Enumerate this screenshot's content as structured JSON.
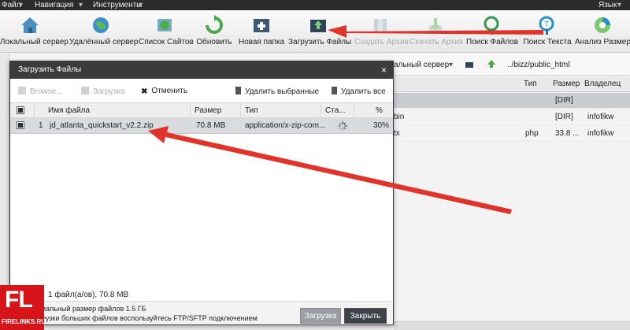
{
  "menubar": {
    "items": [
      "Файл",
      "Навигация",
      "Инструменты"
    ],
    "right": "Язык"
  },
  "toolbar": {
    "buttons": [
      {
        "label": "Локальный сервер",
        "icon": "home-icon"
      },
      {
        "label": "Удалённый сервер",
        "icon": "globe-icon"
      },
      {
        "label": "Список Сайтов",
        "icon": "sites-list-icon"
      },
      {
        "label": "Обновить",
        "icon": "refresh-icon"
      },
      {
        "label": "Новая папка",
        "icon": "new-folder-icon"
      },
      {
        "label": "Загрузить Файлы",
        "icon": "upload-icon"
      },
      {
        "label": "Создать Архив",
        "icon": "archive-icon"
      },
      {
        "label": "Скачать Архив",
        "icon": "download-icon"
      },
      {
        "label": "Поиск Файлов",
        "icon": "search-files-icon"
      },
      {
        "label": "Поиск Текста",
        "icon": "search-text-icon"
      },
      {
        "label": "Анализ Размера",
        "icon": "pie-chart-icon"
      }
    ]
  },
  "background": {
    "server_selector": "альный сервер",
    "path": "../bizz/public_html",
    "columns": {
      "type": "Тип",
      "size": "Размер",
      "owner": "Владелец"
    },
    "rows": [
      {
        "name": "",
        "type": "",
        "size": "[DIR]",
        "owner": ""
      },
      {
        "name": "bin",
        "type": "",
        "size": "[DIR]",
        "owner": "infofikw"
      },
      {
        "name": "tx",
        "type": "php",
        "size": "33.8 ...",
        "owner": "infofikw"
      }
    ]
  },
  "dialog": {
    "title": "Загрузить Файлы",
    "close": "×",
    "tools": {
      "browse": "Browse...",
      "upload": "Загрузка",
      "cancel": "Отменить",
      "delete_selected": "Удалить выбранные",
      "delete_all": "Удалить все"
    },
    "columns": {
      "name": "Имя файла",
      "size": "Размер",
      "type": "Тип",
      "status": "Ста...",
      "percent": "%"
    },
    "files": [
      {
        "index": "1",
        "name": "jd_atlanta_quickstart_v2.2.zip",
        "size": "70.8 MB",
        "type": "application/x-zip-com...",
        "percent": "30%"
      }
    ],
    "summary": "1 файл(а/ов), 70.8 MB",
    "note1": "иальный размер файлов 1.5 ГБ",
    "note2": "рузки больших файлов воспользуйтесь FTP/SFTP подключением",
    "buttons": {
      "upload": "Загрузка",
      "close": "Закрыть"
    }
  },
  "watermark": {
    "big": "FL",
    "small": "FIRELINKS.RU"
  },
  "colors": {
    "accent_arrow": "#e0342b",
    "title_bar": "#3b3b3b",
    "selected_row": "#d9dbde"
  }
}
